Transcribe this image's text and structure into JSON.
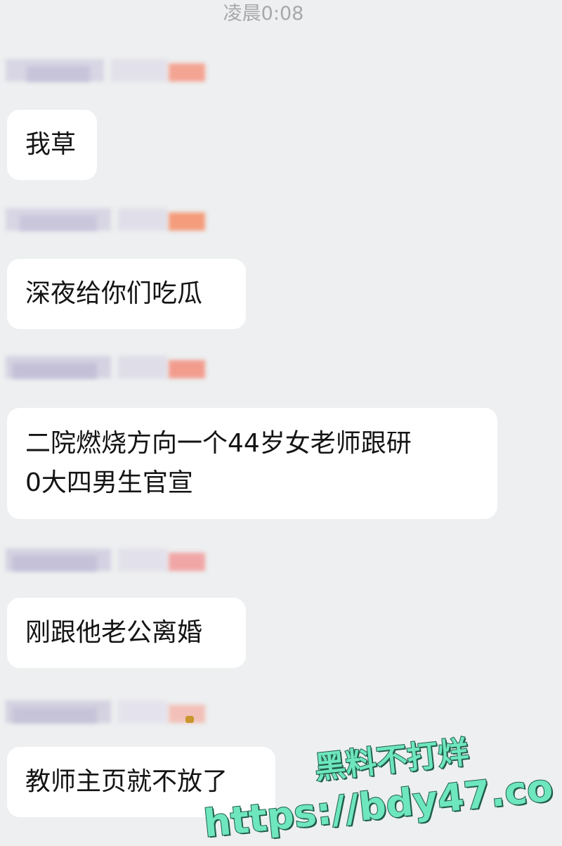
{
  "timestamp": "凌晨0:08",
  "messages": [
    {
      "text": "我草"
    },
    {
      "text": "深夜给你们吃瓜"
    },
    {
      "line1": "二院燃烧方向一个44岁女老师跟研",
      "line2": "0大四男生官宣"
    },
    {
      "text": "刚跟他老公离婚"
    },
    {
      "text": "教师主页就不放了"
    }
  ],
  "watermark": {
    "cn": "黑料不打烊",
    "url": "https://bdy47.co"
  },
  "colors": {
    "background": "#edeff0",
    "bubble": "#ffffff",
    "text": "#141414",
    "timestamp": "#a6a8aa",
    "watermark_fill": "#6ee6be",
    "watermark_stroke": "#1f5c48"
  }
}
